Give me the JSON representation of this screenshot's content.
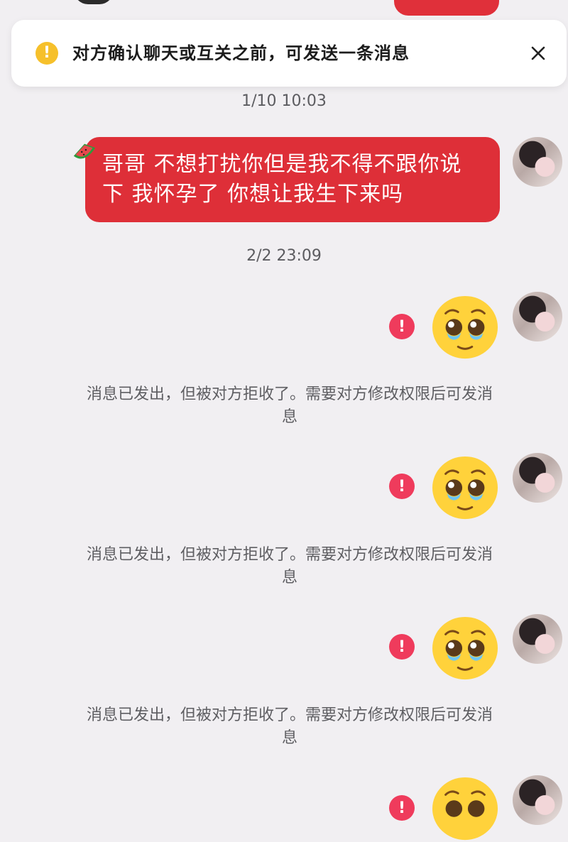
{
  "notice": {
    "text": "对方确认聊天或互关之前，可发送一条消息",
    "icon": "warning-icon",
    "close_icon": "close-icon",
    "icon_color": "#f6c02b"
  },
  "messages": [
    {
      "timestamp": "1/10 10:03",
      "text_line1": "哥哥 不想打扰你但是我不得不跟你说",
      "text_line2": "下 我怀孕了 你想让我生下来吗",
      "bubble_color": "#de2f38"
    }
  ],
  "second_timestamp": "2/2 23:09",
  "failed_messages": [
    {
      "content": "pleading-face-emoji",
      "status": "消息已发出，但被对方拒收了。需要对方修改权限后可发消",
      "status_tail": "息"
    },
    {
      "content": "pleading-face-emoji",
      "status": "消息已发出，但被对方拒收了。需要对方修改权限后可发消",
      "status_tail": "息"
    },
    {
      "content": "pleading-face-emoji",
      "status": "消息已发出，但被对方拒收了。需要对方修改权限后可发消",
      "status_tail": "息"
    }
  ],
  "colors": {
    "background": "#f1eff2",
    "error_badge": "#ef3b5c"
  }
}
